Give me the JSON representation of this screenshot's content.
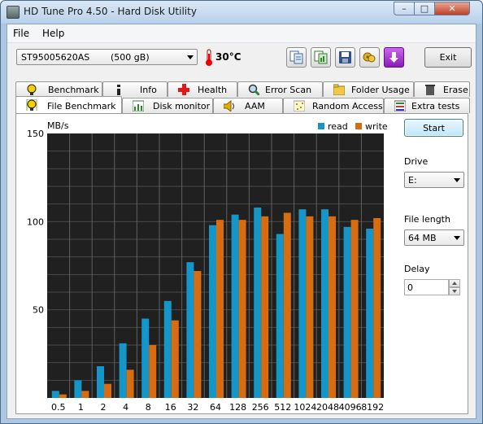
{
  "window": {
    "title": "HD Tune Pro 4.50 - Hard Disk Utility",
    "controls": {
      "minimize": "–",
      "maximize": "□",
      "close": "✕"
    }
  },
  "menu": [
    "File",
    "Help"
  ],
  "toolbar": {
    "drive_name": "ST95005620AS",
    "drive_size": "(500 gB)",
    "temperature": "30°C",
    "exit_label": "Exit",
    "icons": [
      "copy-info-icon",
      "copy-screenshot-icon",
      "save-icon",
      "options-icon",
      "download-icon"
    ]
  },
  "tabs_top": [
    "Benchmark",
    "Info",
    "Health",
    "Error Scan",
    "Folder Usage",
    "Erase"
  ],
  "tabs_bottom": [
    "File Benchmark",
    "Disk monitor",
    "AAM",
    "Random Access",
    "Extra tests"
  ],
  "active_tab": "File Benchmark",
  "controls": {
    "start_label": "Start",
    "drive_label": "Drive",
    "drive_value": "E:",
    "file_length_label": "File length",
    "file_length_value": "64 MB",
    "delay_label": "Delay",
    "delay_value": "0"
  },
  "colors": {
    "read": "#1596c8",
    "write": "#d76d10",
    "plot_bg": "#202020"
  },
  "chart_data": {
    "type": "bar",
    "ylabel": "MB/s",
    "ylim": [
      0,
      150
    ],
    "yticks": [
      50,
      100,
      150
    ],
    "categories": [
      "0.5",
      "1",
      "2",
      "4",
      "8",
      "16",
      "32",
      "64",
      "128",
      "256",
      "512",
      "1024",
      "2048",
      "4096",
      "8192"
    ],
    "series": [
      {
        "name": "read",
        "values": [
          4,
          10,
          18,
          31,
          45,
          55,
          77,
          98,
          104,
          108,
          93,
          107,
          107,
          97,
          96
        ]
      },
      {
        "name": "write",
        "values": [
          2,
          4,
          8,
          16,
          30,
          44,
          72,
          101,
          101,
          103,
          105,
          103,
          103,
          101,
          102
        ]
      }
    ],
    "legend": "top-right",
    "grid": true
  }
}
